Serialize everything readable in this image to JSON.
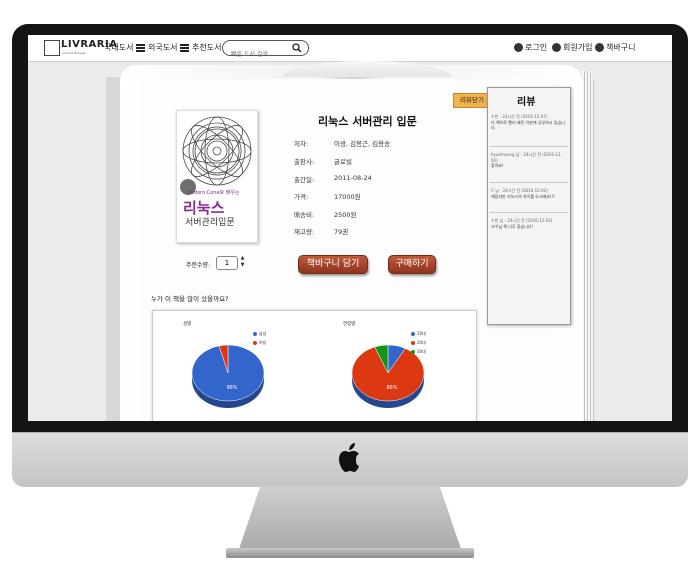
{
  "nav": {
    "logo": "LIVRARIA",
    "logo_sub": "Livraria Brasala",
    "menu": [
      {
        "label": "국내도서"
      },
      {
        "label": "외국도서"
      },
      {
        "label": "추천도서"
      }
    ],
    "search_placeholder": "빠른 도서 검색",
    "right": [
      {
        "label": "로그인",
        "icon": "lock-icon"
      },
      {
        "label": "회원가입",
        "icon": "user-icon"
      },
      {
        "label": "책바구니",
        "icon": "basket-icon"
      }
    ]
  },
  "cover": {
    "subtitle": "Dedoro Cone로 배우는",
    "title": "리눅스",
    "title2": "서버관리입문"
  },
  "book": {
    "title": "리눅스 서버관리 입문",
    "info": [
      {
        "label": "저자:",
        "value": "이광, 김봉근, 김용송"
      },
      {
        "label": "출판사:",
        "value": "글로빌"
      },
      {
        "label": "출간일:",
        "value": "2011-08-24"
      },
      {
        "label": "가격:",
        "value": "17000원"
      },
      {
        "label": "배송비:",
        "value": "2500원"
      },
      {
        "label": "재고량:",
        "value": "79권"
      }
    ]
  },
  "order": {
    "quantity_label": "주문수량:",
    "quantity": "1",
    "cart_button": "책바구니 담기",
    "buy_button": "구매하기"
  },
  "survey": {
    "question": "누가 이 책을 많이 샀을까요?"
  },
  "chart_data": [
    {
      "type": "pie",
      "title": "성별",
      "categories": [
        "남성",
        "여성"
      ],
      "values": [
        96,
        4
      ],
      "center_label": "96%",
      "colors": [
        "#3366cc",
        "#dc3912"
      ]
    },
    {
      "type": "pie",
      "title": "연령별",
      "categories": [
        "10대",
        "20대",
        "30대"
      ],
      "values": [
        8,
        86,
        6
      ],
      "center_label": "86%",
      "colors": [
        "#3366cc",
        "#dc3912",
        "#109618"
      ]
    }
  ],
  "reviews": {
    "title": "리뷰",
    "close_button": "리뷰닫기",
    "items": [
      {
        "meta": "수빈 - 23시간 전 (2016-12-07)",
        "text": "이 책으로 빨리 배운 덕분에 공부하고 있습니다."
      },
      {
        "meta": "hyukmyong 님 - 24시간 전 (2016-12-02)",
        "text": "좋아요!"
      },
      {
        "meta": "C 님 - 24시간 전 (2016-12-02)",
        "text": "재밌지만 리눅스의 차이를 도서에요!!!"
      },
      {
        "meta": "수빈 님 - 24시간 전 (2016-12-02)",
        "text": "고수님 책 너무 좋습니다!"
      }
    ]
  }
}
